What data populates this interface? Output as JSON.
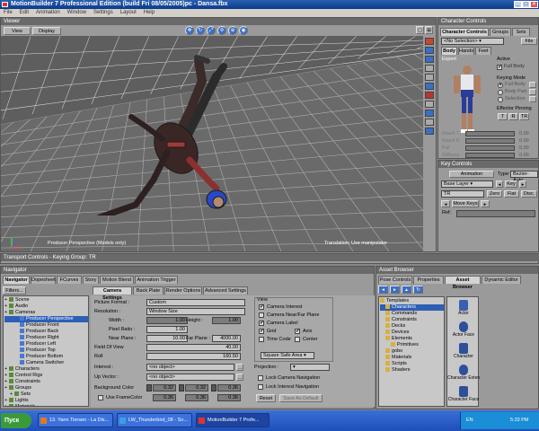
{
  "window": {
    "title": "MotionBuilder 7 Professional Edition (build Fri 08/05/2005)pc - Dansa.fbx",
    "min": "_",
    "max": "□",
    "close": "×"
  },
  "menu": [
    "File",
    "Edit",
    "Animation",
    "Window",
    "Settings",
    "Layout",
    "Help"
  ],
  "viewer": {
    "title": "Viewer",
    "view_btn": "View",
    "display_btn": "Display",
    "camera_label": "Producer Perspective (Models only)",
    "status": "Translation: Use manipulator"
  },
  "character_controls": {
    "title": "Character Controls",
    "tabs": [
      "Character Controls",
      "Groups",
      "Sets"
    ],
    "selection": "<No Selection>",
    "file_btn": "File",
    "body_tabs": [
      "Body",
      "Hands",
      "Feet"
    ],
    "mode": "Expert",
    "active_label": "Active",
    "active_value": "Full Body",
    "keying_mode_label": "Keying Mode",
    "keying_modes": [
      "Full Body",
      "Body Part",
      "Selection"
    ],
    "effector_pinning": "Effector Pinning",
    "pins": [
      "T",
      "R",
      "TR"
    ],
    "sliders": [
      {
        "label": "Reach T",
        "value": "0.00"
      },
      {
        "label": "Reach R",
        "value": "0.00"
      },
      {
        "label": "Pull",
        "value": "0.00"
      },
      {
        "label": "Stiffness",
        "value": "0.00"
      }
    ]
  },
  "key_controls": {
    "title": "Key Controls",
    "animation_btn": "Animation",
    "type_label": "Type:",
    "type_value": "Bezier-Auto",
    "layer": "Base Layer",
    "key_btn": "Key",
    "tr_value": "TR",
    "zero_btn": "Zero",
    "flat_btn": "Flat",
    "disc_btn": "Disc.",
    "move_keys_btn": "Move Keys",
    "ref_label": "Ref:"
  },
  "transport": {
    "title": "Transport Controls  -  Keying Group: TR"
  },
  "navigator": {
    "title": "Navigator",
    "tabs": [
      "Navigator",
      "Dopesheet",
      "FCurves",
      "Story",
      "Motion Blend",
      "Animation Trigger"
    ],
    "filters_btn": "Filters...",
    "tree": [
      {
        "label": "Scene",
        "indent": 0,
        "sel": false
      },
      {
        "label": "Audio",
        "indent": 0,
        "sel": false
      },
      {
        "label": "Cameras",
        "indent": 0,
        "sel": false
      },
      {
        "label": "Producer Perspective",
        "indent": 2,
        "sel": true
      },
      {
        "label": "Producer Front",
        "indent": 2,
        "sel": false
      },
      {
        "label": "Producer Back",
        "indent": 2,
        "sel": false
      },
      {
        "label": "Producer Right",
        "indent": 2,
        "sel": false
      },
      {
        "label": "Producer Left",
        "indent": 2,
        "sel": false
      },
      {
        "label": "Producer Top",
        "indent": 2,
        "sel": false
      },
      {
        "label": "Producer Bottom",
        "indent": 2,
        "sel": false
      },
      {
        "label": "Camera Switcher",
        "indent": 2,
        "sel": false
      },
      {
        "label": "Characters",
        "indent": 0,
        "sel": false
      },
      {
        "label": "Control Rigs",
        "indent": 0,
        "sel": false
      },
      {
        "label": "Constraints",
        "indent": 0,
        "sel": false
      },
      {
        "label": "Groups",
        "indent": 0,
        "sel": false
      },
      {
        "label": "Sets",
        "indent": 1,
        "sel": false
      },
      {
        "label": "Lights",
        "indent": 0,
        "sel": false
      },
      {
        "label": "Materials",
        "indent": 0,
        "sel": false
      }
    ],
    "subtabs": [
      "Camera Settings",
      "Back Plate",
      "Render Options",
      "Advanced Settings"
    ],
    "picture_format_label": "Picture Format :",
    "picture_format": "Custom",
    "resolution_label": "Resolution :",
    "resolution": "Window Size",
    "width_label": "Width :",
    "width": "1.00",
    "height_label": "Height :",
    "height": "1.00",
    "pixel_ratio_label": "Pixel Ratio :",
    "pixel_ratio": "1.00",
    "near_label": "Near Plane :",
    "near": "10.00",
    "far_label": "Far Plane :",
    "far": "4000.00",
    "fov_label": "Field Of View",
    "fov": "40.00",
    "roll_label": "Roll",
    "roll": "160.50",
    "interest_label": "Interest :",
    "interest": "<no object>",
    "upvector_label": "Up Vector :",
    "upvector": "<no object>",
    "bgcolor_label": "Background Color",
    "bgcolor": [
      "0.32",
      "0.32",
      "0.36"
    ],
    "frame_label": "Use FrameColor",
    "frame": [
      "0.36",
      "0.36",
      "0.36"
    ],
    "view_group": "View",
    "checks": [
      {
        "label": "Camera Interest",
        "on": true
      },
      {
        "label": "Camera Near/Far Plane",
        "on": false
      },
      {
        "label": "Camera Label",
        "on": true
      },
      {
        "label": "Grid",
        "on": true
      },
      {
        "label": "Axis",
        "on": true
      },
      {
        "label": "Time Code",
        "on": false
      },
      {
        "label": "Center",
        "on": false
      }
    ],
    "safe_area": "Square Safe Area",
    "projection_label": "Projection :",
    "lock_nav": "Lock Camera Navigation",
    "lock_interest": "Lock Interest Navigation",
    "reset_btn": "Reset",
    "save_default_btn": "Save As Default"
  },
  "asset_browser": {
    "title": "Asset Browser",
    "tabs": [
      "Pose Controls",
      "Properties",
      "Asset Browser",
      "Dynamic Editor"
    ],
    "tree": [
      {
        "label": "Templates",
        "indent": 0,
        "sel": false
      },
      {
        "label": "Characters",
        "indent": 1,
        "sel": true
      },
      {
        "label": "Commands",
        "indent": 1,
        "sel": false
      },
      {
        "label": "Constraints",
        "indent": 1,
        "sel": false
      },
      {
        "label": "Decks",
        "indent": 1,
        "sel": false
      },
      {
        "label": "Devices",
        "indent": 1,
        "sel": false
      },
      {
        "label": "Elements",
        "indent": 1,
        "sel": false
      },
      {
        "label": "Primitives",
        "indent": 2,
        "sel": false
      },
      {
        "label": "gobo",
        "indent": 1,
        "sel": false
      },
      {
        "label": "Materials",
        "indent": 1,
        "sel": false
      },
      {
        "label": "Scripts",
        "indent": 1,
        "sel": false
      },
      {
        "label": "Shaders",
        "indent": 1,
        "sel": false
      }
    ],
    "items": [
      "Actor",
      "Actor Face",
      "Character",
      "Character Extension",
      "Character Face"
    ]
  },
  "taskbar": {
    "start": "Пуск",
    "items": [
      "13. Yann Tiersen - La Dis...",
      "LW_Thunderbird_08 - So...",
      "MotionBuilder 7 Profe..."
    ],
    "lang": "EN",
    "time": "5:33 PM"
  },
  "colors": {
    "viewport": "#5e5e5e",
    "accent": "#2d5fb5",
    "panel": "#9a9a9a",
    "taskbar": "#2b5cc7"
  }
}
